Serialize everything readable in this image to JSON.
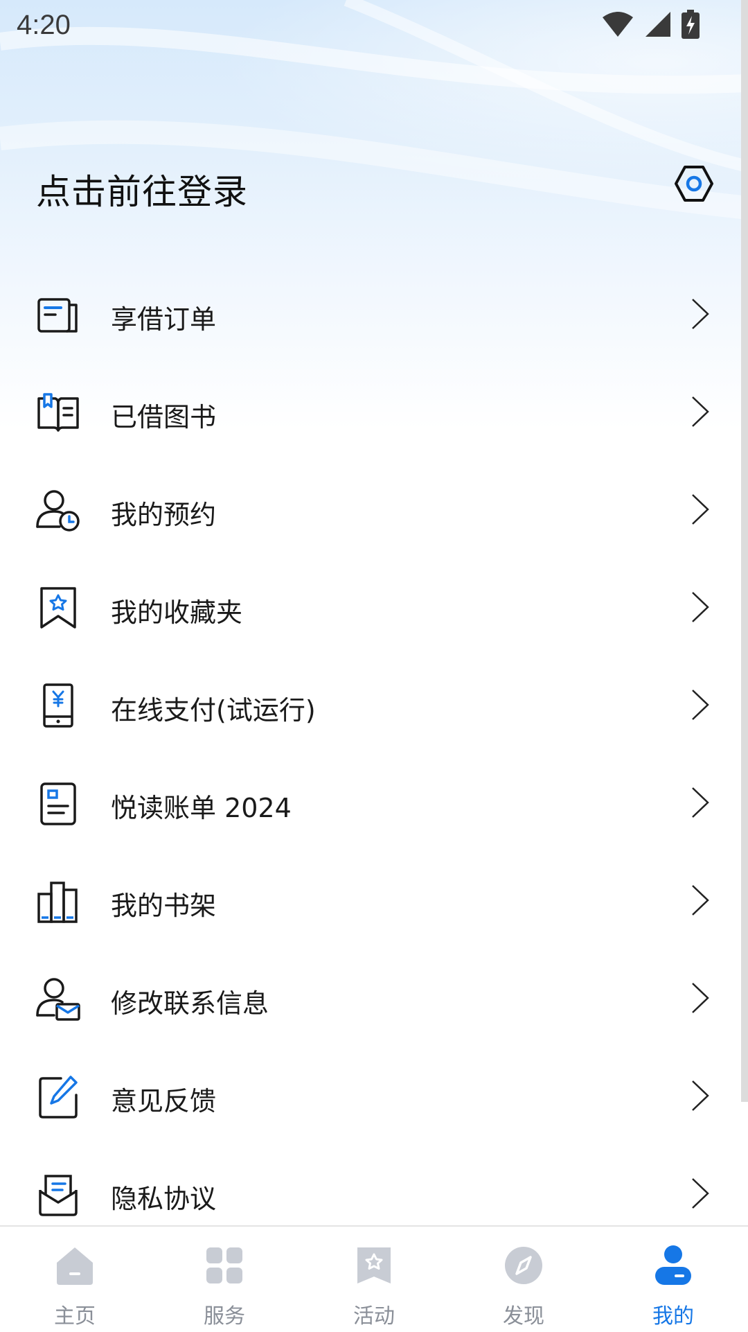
{
  "status_bar": {
    "time": "4:20"
  },
  "header": {
    "login_text": "点击前往登录"
  },
  "menu": {
    "items": [
      {
        "label": "享借订单",
        "icon": "order-icon"
      },
      {
        "label": "已借图书",
        "icon": "borrowed-book-icon"
      },
      {
        "label": "我的预约",
        "icon": "reservation-icon"
      },
      {
        "label": "我的收藏夹",
        "icon": "favorites-icon"
      },
      {
        "label": "在线支付(试运行)",
        "icon": "mobile-payment-icon"
      },
      {
        "label": "悦读账单 2024",
        "icon": "reading-bill-icon"
      },
      {
        "label": "我的书架",
        "icon": "bookshelf-icon"
      },
      {
        "label": "修改联系信息",
        "icon": "contact-info-icon"
      },
      {
        "label": "意见反馈",
        "icon": "feedback-icon"
      },
      {
        "label": "隐私协议",
        "icon": "privacy-icon"
      }
    ]
  },
  "tabbar": {
    "tabs": [
      {
        "label": "主页",
        "icon": "home-icon"
      },
      {
        "label": "服务",
        "icon": "services-grid-icon"
      },
      {
        "label": "活动",
        "icon": "activity-star-icon"
      },
      {
        "label": "发现",
        "icon": "discover-compass-icon"
      },
      {
        "label": "我的",
        "icon": "profile-icon"
      }
    ],
    "active_index": 4
  },
  "colors": {
    "accent": "#1677e6",
    "icon_stroke": "#1a1a1a",
    "tab_inactive": "#8a8f98",
    "tab_icon_inactive": "#c8ccd4"
  }
}
